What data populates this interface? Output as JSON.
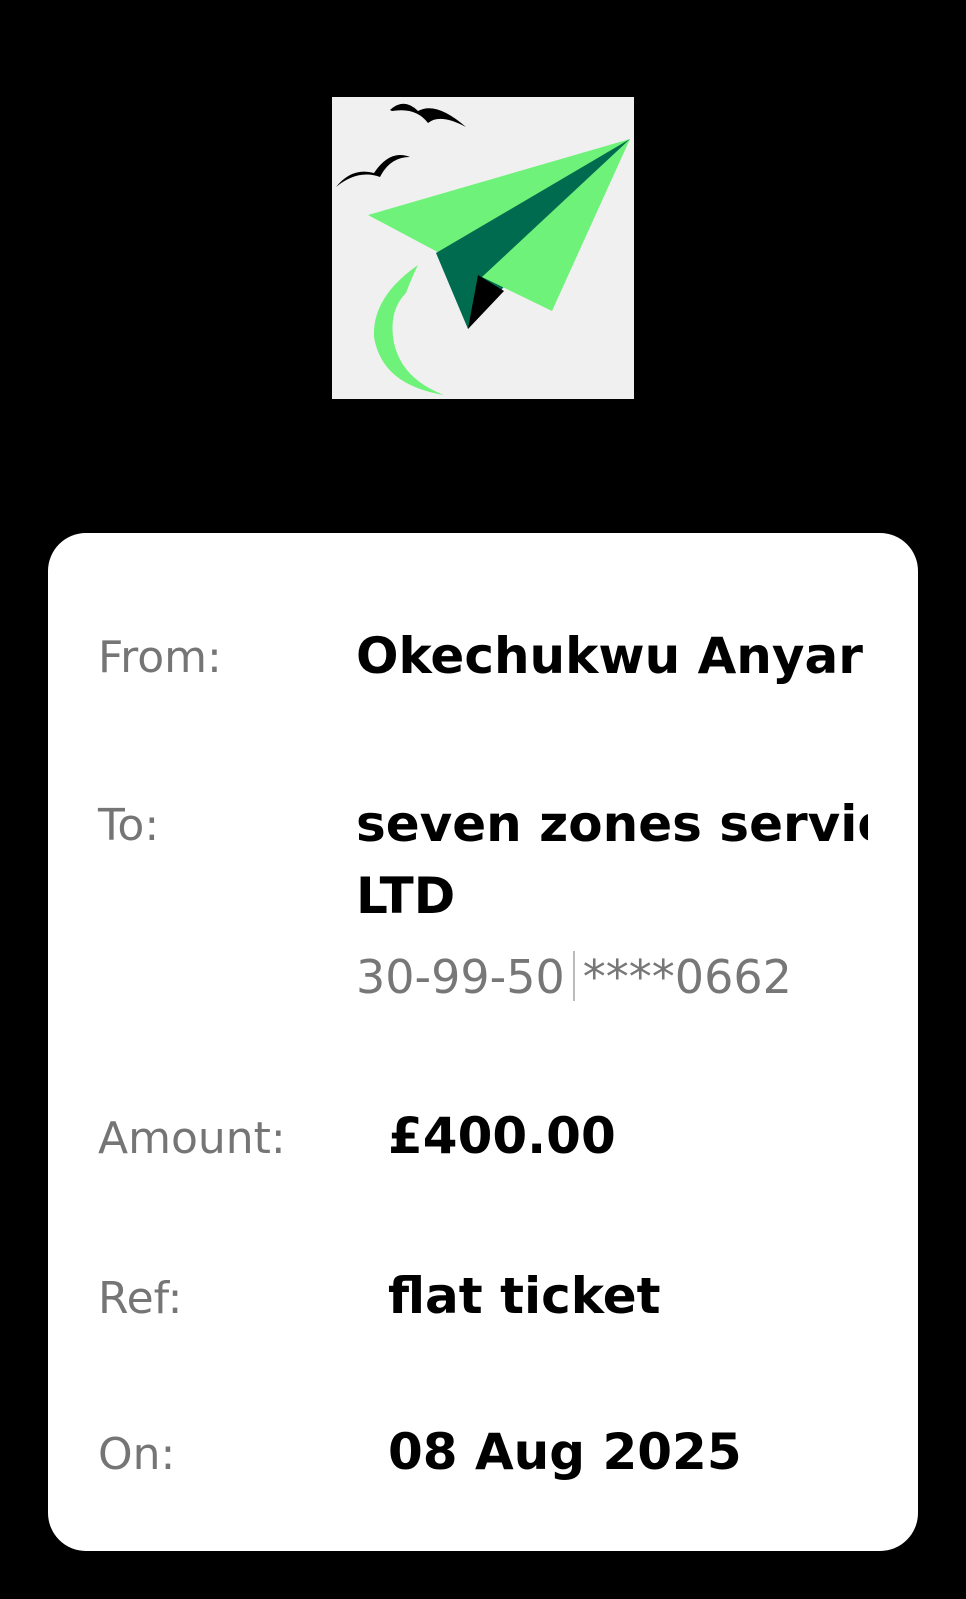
{
  "logo": {
    "icon": "paper-plane-logo-icon",
    "colors": {
      "plane_light": "#6ff27a",
      "plane_dark": "#006b4e",
      "background": "#f0f0f0"
    }
  },
  "details": {
    "from": {
      "label": "From:",
      "value": "Okechukwu Anyar"
    },
    "to": {
      "label": "To:",
      "value_line1": "seven zones servic",
      "value_line2": "LTD",
      "sort_code": "30-99-50",
      "account": "****0662"
    },
    "amount": {
      "label": "Amount:",
      "value": "£400.00"
    },
    "ref": {
      "label": "Ref:",
      "value": "flat ticket"
    },
    "on": {
      "label": "On:",
      "value": "08 Aug 2025"
    }
  }
}
